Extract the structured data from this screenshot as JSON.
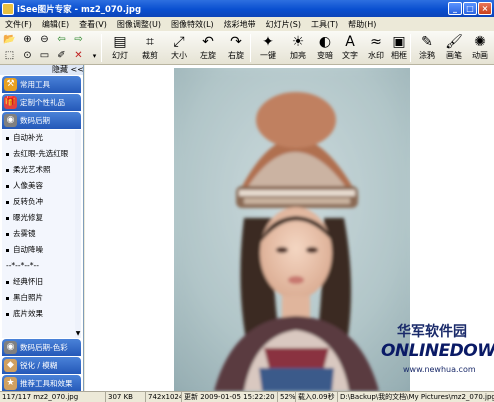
{
  "window": {
    "title": "iSee图片专家 - mz2_070.jpg",
    "minimize": "_",
    "maximize": "□",
    "close": "×"
  },
  "menu": [
    "文件(F)",
    "编辑(E)",
    "查看(V)",
    "图像调整(U)",
    "图像特效(L)",
    "炫彩地带",
    "幻灯片(S)",
    "工具(T)",
    "帮助(H)"
  ],
  "toolbar": {
    "tools": [
      {
        "label": "幻灯",
        "icon": "slideshow-icon",
        "glyph": "▤"
      },
      {
        "label": "裁剪",
        "icon": "crop-icon",
        "glyph": "⌗"
      },
      {
        "label": "大小",
        "icon": "resize-icon",
        "glyph": "⤢"
      },
      {
        "label": "左旋",
        "icon": "rotate-left-icon",
        "glyph": "↶"
      },
      {
        "label": "右旋",
        "icon": "rotate-right-icon",
        "glyph": "↷"
      },
      {
        "label": "一键",
        "icon": "one-click-icon",
        "glyph": "✦"
      },
      {
        "label": "加亮",
        "icon": "brighten-icon",
        "glyph": "☀"
      },
      {
        "label": "变暗",
        "icon": "darken-icon",
        "glyph": "◐"
      },
      {
        "label": "文字",
        "icon": "text-icon",
        "glyph": "A"
      },
      {
        "label": "水印",
        "icon": "watermark-icon",
        "glyph": "≈"
      },
      {
        "label": "相框",
        "icon": "frame-icon",
        "glyph": "▣"
      },
      {
        "label": "涂鸦",
        "icon": "doodle-icon",
        "glyph": "✎"
      },
      {
        "label": "画笔",
        "icon": "brush-icon",
        "glyph": "🖌"
      },
      {
        "label": "动画",
        "icon": "animation-icon",
        "glyph": "✺"
      }
    ]
  },
  "sidebar": {
    "hide_label": "隐藏 <<",
    "groups_top": [
      {
        "label": "常用工具",
        "icon": "tools-icon",
        "glyph": "⚒",
        "color": "#e8a020"
      },
      {
        "label": "定制个性礼品",
        "icon": "gift-icon",
        "glyph": "🎁",
        "color": "#e04040"
      },
      {
        "label": "数码后期",
        "icon": "camera-icon",
        "glyph": "◉",
        "color": "#808080"
      }
    ],
    "items": [
      "自动补光",
      "去红眼-先选红眼",
      "柔光艺术照",
      "人像美容",
      "反转负冲",
      "曝光修复",
      "去雾镜",
      "自动降噪",
      "--*--*--*--",
      "经典怀旧",
      "黑白照片",
      "底片效果"
    ],
    "groups_bottom": [
      {
        "label": "数码后期-色彩",
        "icon": "color-icon",
        "glyph": "◉",
        "color": "#808080"
      },
      {
        "label": "锐化 / 模糊",
        "icon": "sharpen-icon",
        "glyph": "◆",
        "color": "#d0a060"
      },
      {
        "label": "推荐工具和效果",
        "icon": "recommend-icon",
        "glyph": "★",
        "color": "#d0a060"
      }
    ]
  },
  "watermark": {
    "cn": "华军软件园",
    "en": "ONLINEDOWN",
    "url": "www.newhua.com"
  },
  "status": {
    "file": "117/117 mz2_070.jpg",
    "size": "307 KB",
    "dimensions": "742x1024",
    "modified": "更新 2009-01-05 15:22:20",
    "zoom": "52%",
    "load": "载入0.09秒",
    "path": "D:\\Backup\\我的文档\\My Pictures\\mz2_070.jpg"
  }
}
